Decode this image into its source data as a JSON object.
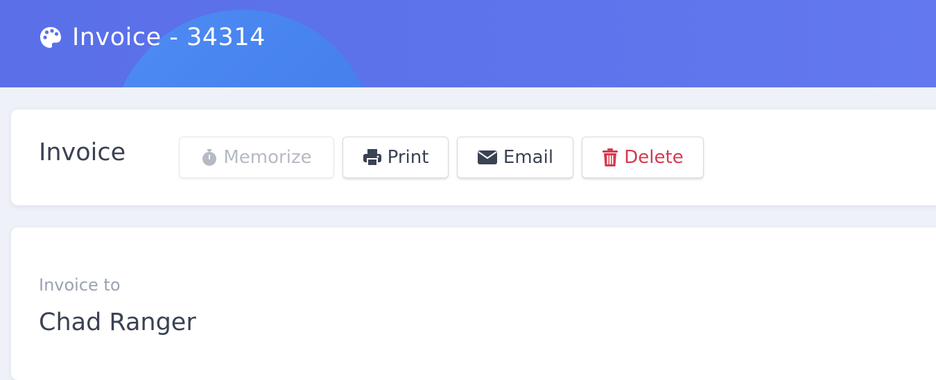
{
  "header": {
    "title": "Invoice - 34314",
    "icon": "palette-icon",
    "gradient_start": "#5a6fe8",
    "gradient_end": "#6378ee",
    "circle_color": "#4f8cf3"
  },
  "toolbar": {
    "title": "Invoice",
    "buttons": [
      {
        "label": "Memorize",
        "icon": "stopwatch-icon",
        "state": "disabled"
      },
      {
        "label": "Print",
        "icon": "printer-icon"
      },
      {
        "label": "Email",
        "icon": "envelope-icon"
      },
      {
        "label": "Delete",
        "icon": "trash-icon",
        "color": "#d43a4f"
      }
    ]
  },
  "invoice": {
    "to_label": "Invoice to",
    "to_name": "Chad Ranger"
  }
}
